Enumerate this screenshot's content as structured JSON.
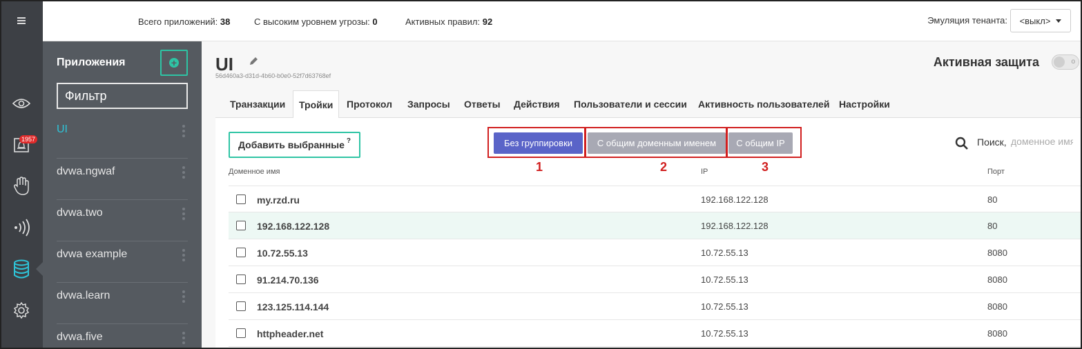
{
  "topbar": {
    "stats": [
      {
        "label": "Всего приложений:",
        "value": "38"
      },
      {
        "label": "С высоким уровнем угрозы:",
        "value": "0"
      },
      {
        "label": "Активных правил:",
        "value": "92"
      }
    ],
    "tenant_label": "Эмуляция тенанта:",
    "tenant_value": "<выкл>"
  },
  "rail": {
    "icons": [
      "menu-icon",
      "eye-icon",
      "alert-icon",
      "hand-icon",
      "signal-icon",
      "database-icon",
      "gear-icon"
    ],
    "badge": "1957"
  },
  "apps": {
    "title": "Приложения",
    "filter_placeholder": "Фильтр",
    "items": [
      {
        "label": "UI",
        "active": true
      },
      {
        "label": "dvwa.ngwaf"
      },
      {
        "label": "dvwa.two"
      },
      {
        "label": "dvwa example"
      },
      {
        "label": "dvwa.learn"
      },
      {
        "label": "dvwa.five"
      }
    ]
  },
  "app": {
    "name": "UI",
    "id": "56d460a3-d31d-4b60-b0e0-52f7d63768ef",
    "protection_label": "Активная защита"
  },
  "tabs": [
    "Транзакции",
    "Тройки",
    "Протокол",
    "Запросы",
    "Ответы",
    "Действия",
    "Пользователи и сессии",
    "Активность пользователей",
    "Настройки"
  ],
  "active_tab": "Тройки",
  "toolbar": {
    "add_selected": "Добавить выбранные",
    "help": "?",
    "grouping": [
      "Без группировки",
      "С общим доменным именем",
      "С общим IP"
    ],
    "annotations": [
      "1",
      "2",
      "3"
    ],
    "search_label": "Поиск,",
    "search_placeholder": "доменное имя"
  },
  "table": {
    "headers": [
      "Доменное имя",
      "IP",
      "Порт"
    ],
    "rows": [
      {
        "domain": "my.rzd.ru",
        "ip": "192.168.122.128",
        "port": "80"
      },
      {
        "domain": "192.168.122.128",
        "ip": "192.168.122.128",
        "port": "80"
      },
      {
        "domain": "10.72.55.13",
        "ip": "10.72.55.13",
        "port": "8080"
      },
      {
        "domain": "91.214.70.136",
        "ip": "10.72.55.13",
        "port": "8080"
      },
      {
        "domain": "123.125.114.144",
        "ip": "10.72.55.13",
        "port": "8080"
      },
      {
        "domain": "httpheader.net",
        "ip": "10.72.55.13",
        "port": "8080"
      }
    ]
  },
  "colors": {
    "rail_bg": "#3d4045",
    "sidebar_bg": "#555a60",
    "accent_teal": "#2ec4a4",
    "active_link": "#2ec4d8",
    "group_active": "#5a64c8",
    "group_inactive": "#a8a9b4",
    "annotation_red": "#d11f1f",
    "badge_red": "#e02b2b"
  }
}
